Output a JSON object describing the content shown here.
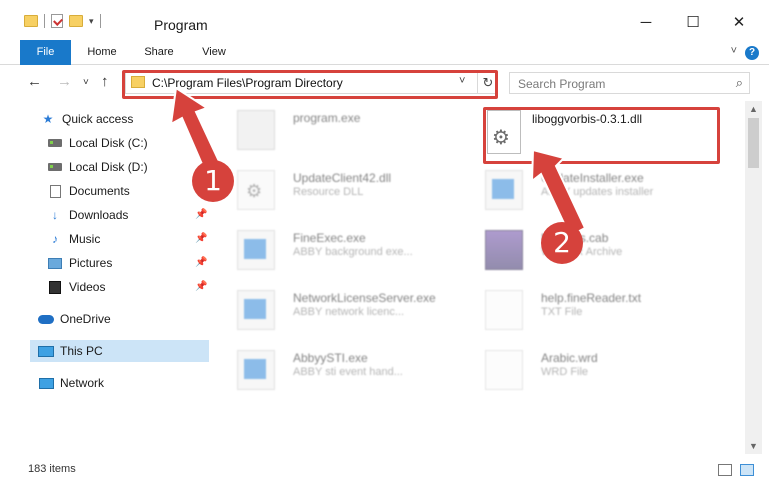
{
  "window": {
    "title": "Program",
    "controls": {
      "minimize": "─",
      "maximize": "☐",
      "close": "✕"
    }
  },
  "ribbon": {
    "tabs": [
      "File",
      "Home",
      "Share",
      "View"
    ]
  },
  "nav": {
    "address": "C:\\Program Files\\Program Directory",
    "search_placeholder": "Search Program"
  },
  "sidebar": {
    "items": [
      {
        "label": "Quick access",
        "icon": "star-icon"
      },
      {
        "label": "Local Disk (C:)",
        "icon": "drive-icon"
      },
      {
        "label": "Local Disk (D:)",
        "icon": "drive-icon"
      },
      {
        "label": "Documents",
        "icon": "document-icon"
      },
      {
        "label": "Downloads",
        "icon": "download-icon",
        "pinned": true
      },
      {
        "label": "Music",
        "icon": "music-icon",
        "pinned": true
      },
      {
        "label": "Pictures",
        "icon": "pictures-icon",
        "pinned": true
      },
      {
        "label": "Videos",
        "icon": "video-icon",
        "pinned": true
      },
      {
        "label": "OneDrive",
        "icon": "cloud-icon"
      },
      {
        "label": "This PC",
        "icon": "computer-icon",
        "selected": true
      },
      {
        "label": "Network",
        "icon": "network-icon"
      }
    ]
  },
  "files": {
    "highlighted": {
      "name": "liboggvorbis-0.3.1.dll"
    },
    "blurred": [
      {
        "name": "program.exe",
        "desc": ""
      },
      {
        "name": "UpdateClient42.dll",
        "desc": "Resource DLL"
      },
      {
        "name": "UpdateInstaller.exe",
        "desc": "ABBY updates installer"
      },
      {
        "name": "FineExec.exe",
        "desc": "ABBY background exe..."
      },
      {
        "name": "Updates.cab",
        "desc": "WinRAR Archive"
      },
      {
        "name": "NetworkLicenseServer.exe",
        "desc": "ABBY network licenc..."
      },
      {
        "name": "help.fineReader.txt",
        "desc": "TXT File"
      },
      {
        "name": "AbbyySTI.exe",
        "desc": "ABBY sti event hand..."
      },
      {
        "name": "Arabic.wrd",
        "desc": "WRD File"
      }
    ]
  },
  "annotations": {
    "badge1": "1",
    "badge2": "2",
    "color": "#d6423c"
  },
  "status": {
    "count": "183 items"
  }
}
